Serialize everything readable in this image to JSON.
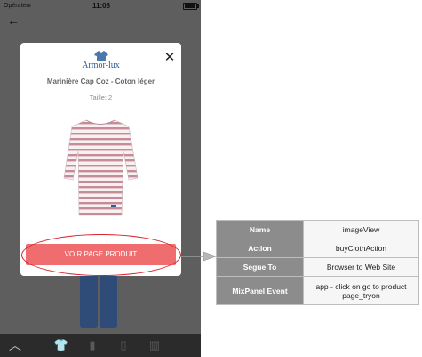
{
  "status_bar": {
    "carrier": "Opérateur",
    "time": "11:08"
  },
  "modal": {
    "brand": "Armor-lux",
    "product_title": "Marinière Cap Coz - Coton léger",
    "size_label": "Taille: 2",
    "cta_label": "VOIR PAGE PRODUIT",
    "close_symbol": "✕"
  },
  "annotation": {
    "rows": [
      {
        "key": "Name",
        "value": "imageView"
      },
      {
        "key": "Action",
        "value": "buyClothAction"
      },
      {
        "key": "Segue To",
        "value": "Browser to Web Site"
      },
      {
        "key": "MixPanel  Event",
        "value": "app - click on go to product page_tryon"
      }
    ]
  },
  "colors": {
    "cta": "#f06d6f",
    "brand_blue": "#2a5e95",
    "highlight": "#d6202b",
    "table_key_bg": "#8c8c8c"
  },
  "icons": [
    "back-arrow-icon",
    "close-icon",
    "chevron-up-icon",
    "shirt-icon",
    "pants-icon",
    "jacket-icon"
  ]
}
